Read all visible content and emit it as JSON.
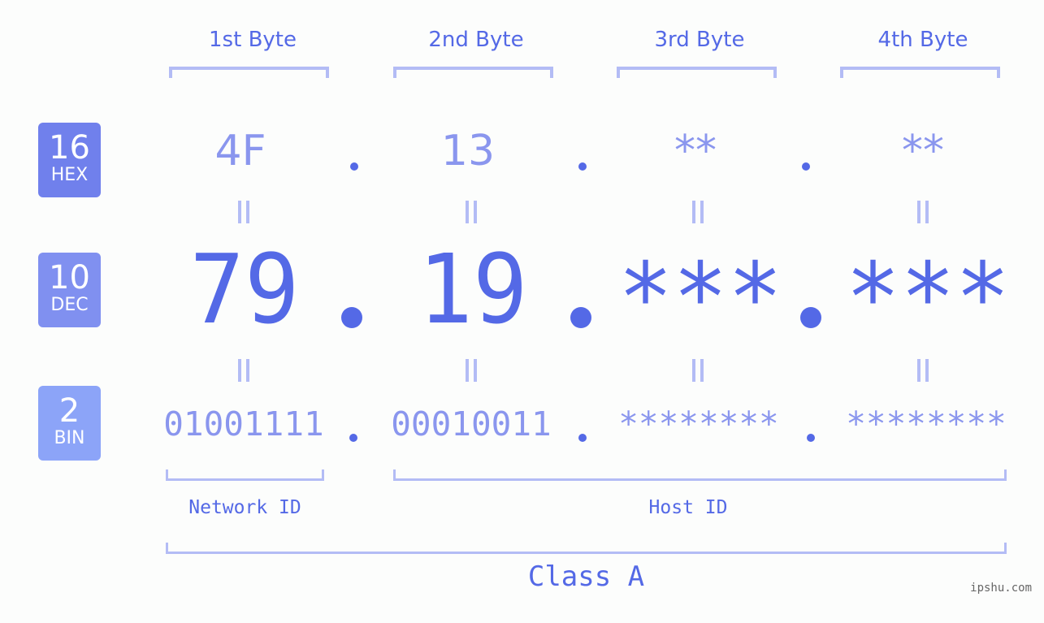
{
  "colors": {
    "accent": "#5469e6",
    "light_value": "#8a96ee",
    "bracket": "#b3bcf5",
    "hex_badge": "#7080ec",
    "dec_badge": "#8090f0",
    "bin_badge": "#8ca4f8",
    "background": "#fcfdfc"
  },
  "byte_headers": [
    "1st Byte",
    "2nd Byte",
    "3rd Byte",
    "4th Byte"
  ],
  "badges": {
    "hex": {
      "number": "16",
      "label": "HEX"
    },
    "dec": {
      "number": "10",
      "label": "DEC"
    },
    "bin": {
      "number": "2",
      "label": "BIN"
    }
  },
  "hex": [
    "4F",
    "13",
    "**",
    "**"
  ],
  "dec": [
    "79",
    "19",
    "***",
    "***"
  ],
  "bin": [
    "01001111",
    "00010011",
    "********",
    "********"
  ],
  "separator": ".",
  "equals_symbol": "||",
  "network_id_label": "Network ID",
  "host_id_label": "Host ID",
  "class_label": "Class A",
  "watermark": "ipshu.com"
}
